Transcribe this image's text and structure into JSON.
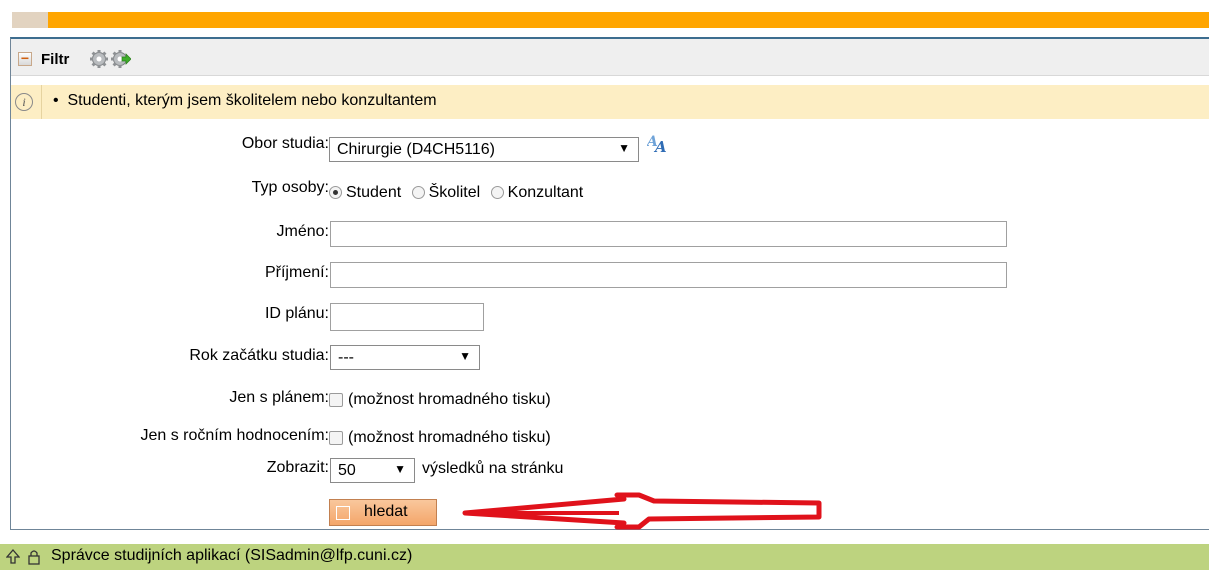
{
  "filter": {
    "title": "Filtr",
    "info_bullet": "•",
    "info_text": "Studenti, kterým jsem školitelem nebo konzultantem"
  },
  "form": {
    "obor_label": "Obor studia:",
    "obor_value": "Chirurgie (D4CH5116)",
    "typ_label": "Typ osoby:",
    "typ_options": [
      "Student",
      "Školitel",
      "Konzultant"
    ],
    "typ_selected": "Student",
    "jmeno_label": "Jméno:",
    "jmeno_value": "",
    "prijmeni_label": "Příjmení:",
    "prijmeni_value": "",
    "id_label": "ID plánu:",
    "id_value": "",
    "rok_label": "Rok začátku studia:",
    "rok_value": "---",
    "plan_label": "Jen s plánem:",
    "plan_note": "(možnost hromadného tisku)",
    "rocni_label": "Jen s ročním hodnocením:",
    "rocni_note": "(možnost hromadného tisku)",
    "zobrazit_label": "Zobrazit:",
    "zobrazit_value": "50",
    "zobrazit_suffix": "výsledků na stránku",
    "search_label": "hledat"
  },
  "footer": {
    "text": "Správce studijních aplikací (SISadmin@lfp.cuni.cz)"
  },
  "colors": {
    "top_bar": "#ffa500",
    "info_bg": "#fdeec4",
    "footer_bg": "#bdd37f",
    "button_bg": "#f4a66a",
    "annotation_arrow": "#e0121b"
  },
  "icons": [
    "collapse-icon",
    "gear-icon",
    "gear-arrow-icon",
    "info-icon",
    "translate-icon",
    "magnifier-icon",
    "up-arrow-icon",
    "lock-icon",
    "red-arrow-annotation"
  ]
}
